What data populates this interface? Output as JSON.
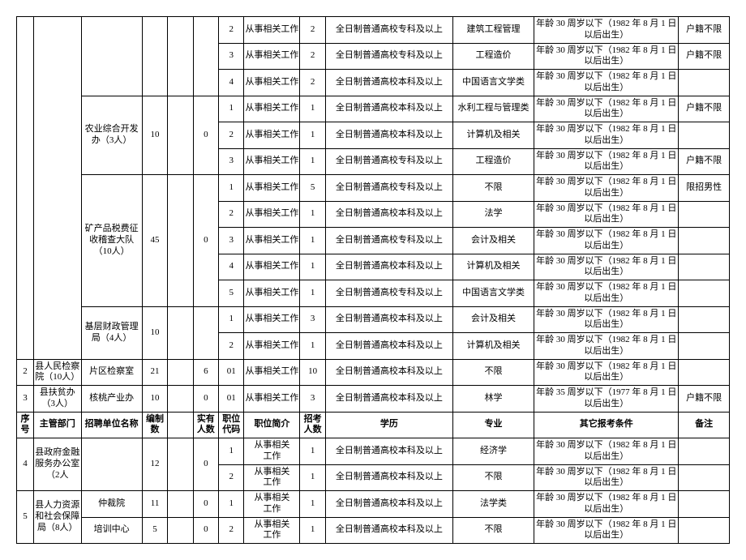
{
  "header": {
    "seq": "序号",
    "dept": "主管部门",
    "unit": "招聘单位名称",
    "estab": "编制数",
    "actual": "实有人数",
    "poscode": "职位代码",
    "posdesc": "职位简介",
    "recruit": "招考人数",
    "edu": "学历",
    "major": "专业",
    "other": "其它报考条件",
    "remark": "备注"
  },
  "common": {
    "work": "从事相关工作",
    "work2l": "从事相关\n工作",
    "edu_zk": "全日制普通高校专科及以上",
    "edu_bk": "全日制普通高校本科及以上",
    "age30": "年龄 30 周岁以下（1982 年 8 月 1 日以后出生）",
    "age35": "年龄 35 周岁以下（1977 年 8 月 1 日以后出生）",
    "huji": "户籍不限",
    "male": "限招男性",
    "unlimited": "不限"
  },
  "depts": {
    "jiancha": "县人民检察院（10人）",
    "fupin": "县扶贫办（3人）",
    "jinrong": "县政府金融服务办公室（2人",
    "renshe": "县人力资源和社会保障局（8人）"
  },
  "units": {
    "nongye": "农业综合开发办（3人）",
    "kuangchan": "矿产品税费征收稽查大队（10人）",
    "jiceng": "基层财政管理局（4人）",
    "pianqu": "片区检察室",
    "hetao": "核桃产业办",
    "zhongcai": "仲裁院",
    "peixun": "培训中心"
  },
  "majors": {
    "jianzhu": "建筑工程管理",
    "zaojia": "工程造价",
    "zhongwen": "中国语言文学类",
    "shuili": "水利工程与管理类",
    "jisuanji": "计算机及相关",
    "faxue": "法学",
    "kuaiji": "会计及相关",
    "linxue": "林学",
    "jingji": "经济学",
    "faxuelei": "法学类"
  },
  "nums": {
    "n0": "0",
    "n01": "01",
    "n1": "1",
    "n2": "2",
    "n3": "3",
    "n4": "4",
    "n5": "5",
    "n6": "6",
    "n10": "10",
    "n11": "11",
    "n12": "12",
    "n21": "21",
    "n45": "45"
  }
}
